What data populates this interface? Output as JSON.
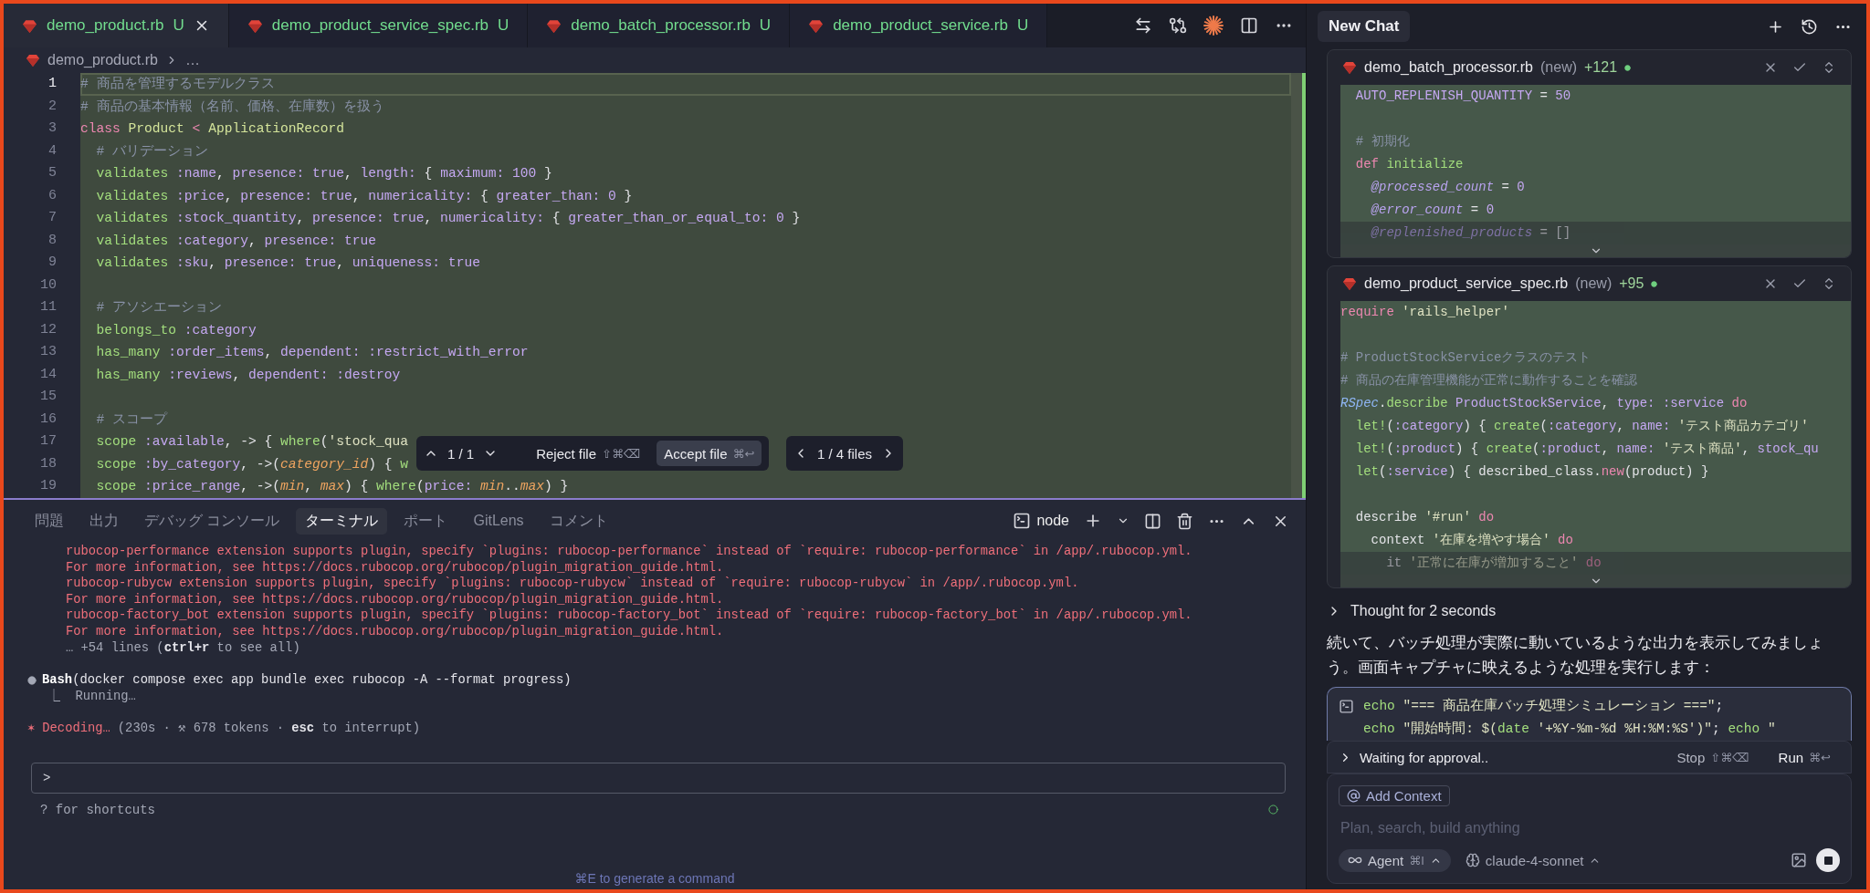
{
  "editor_tabs": [
    {
      "label": "demo_product.rb",
      "status": "U",
      "selected": true
    },
    {
      "label": "demo_product_service_spec.rb",
      "status": "U",
      "selected": false
    },
    {
      "label": "demo_batch_processor.rb",
      "status": "U",
      "selected": false
    },
    {
      "label": "demo_product_service.rb",
      "status": "U",
      "selected": false
    }
  ],
  "breadcrumb": {
    "file": "demo_product.rb",
    "trail": "…"
  },
  "editor": {
    "lines": [
      {
        "number": "1",
        "current": true,
        "added": true,
        "tokens": [
          {
            "kind": "comment",
            "text": "# 商品を管理するモデルクラス"
          }
        ]
      },
      {
        "number": "2",
        "current": false,
        "added": true,
        "tokens": [
          {
            "kind": "comment",
            "text": "# 商品の基本情報（名前、価格、在庫数）を扱う"
          }
        ]
      },
      {
        "number": "3",
        "current": false,
        "added": true,
        "tokens": [
          {
            "kind": "keyword",
            "text": "class"
          },
          {
            "kind": "const",
            "text": " Product"
          },
          {
            "kind": "keyword",
            "text": " <"
          },
          {
            "kind": "const",
            "text": " ApplicationRecord"
          }
        ]
      },
      {
        "number": "4",
        "current": false,
        "added": true,
        "tokens": [
          {
            "kind": "comment",
            "text": "  # バリデーション"
          }
        ]
      },
      {
        "number": "5",
        "current": false,
        "added": true,
        "tokens": [
          {
            "kind": "method",
            "text": "  validates"
          },
          {
            "kind": "symbol",
            "text": " :name"
          },
          {
            "kind": "plain",
            "text": ", "
          },
          {
            "kind": "symbol",
            "text": "presence: true"
          },
          {
            "kind": "plain",
            "text": ", "
          },
          {
            "kind": "symbol",
            "text": "length:"
          },
          {
            "kind": "plain",
            "text": " { "
          },
          {
            "kind": "symbol",
            "text": "maximum: 100"
          },
          {
            "kind": "plain",
            "text": " }"
          }
        ]
      },
      {
        "number": "6",
        "current": false,
        "added": true,
        "tokens": [
          {
            "kind": "method",
            "text": "  validates"
          },
          {
            "kind": "symbol",
            "text": " :price"
          },
          {
            "kind": "plain",
            "text": ", "
          },
          {
            "kind": "symbol",
            "text": "presence: true"
          },
          {
            "kind": "plain",
            "text": ", "
          },
          {
            "kind": "symbol",
            "text": "numericality:"
          },
          {
            "kind": "plain",
            "text": " { "
          },
          {
            "kind": "symbol",
            "text": "greater_than: 0"
          },
          {
            "kind": "plain",
            "text": " }"
          }
        ]
      },
      {
        "number": "7",
        "current": false,
        "added": true,
        "tokens": [
          {
            "kind": "method",
            "text": "  validates"
          },
          {
            "kind": "symbol",
            "text": " :stock_quantity"
          },
          {
            "kind": "plain",
            "text": ", "
          },
          {
            "kind": "symbol",
            "text": "presence: true"
          },
          {
            "kind": "plain",
            "text": ", "
          },
          {
            "kind": "symbol",
            "text": "numericality:"
          },
          {
            "kind": "plain",
            "text": " { "
          },
          {
            "kind": "symbol",
            "text": "greater_than_or_equal_to: 0"
          },
          {
            "kind": "plain",
            "text": " }"
          }
        ]
      },
      {
        "number": "8",
        "current": false,
        "added": true,
        "tokens": [
          {
            "kind": "method",
            "text": "  validates"
          },
          {
            "kind": "symbol",
            "text": " :category"
          },
          {
            "kind": "plain",
            "text": ", "
          },
          {
            "kind": "symbol",
            "text": "presence: true"
          }
        ]
      },
      {
        "number": "9",
        "current": false,
        "added": true,
        "tokens": [
          {
            "kind": "method",
            "text": "  validates"
          },
          {
            "kind": "symbol",
            "text": " :sku"
          },
          {
            "kind": "plain",
            "text": ", "
          },
          {
            "kind": "symbol",
            "text": "presence: true"
          },
          {
            "kind": "plain",
            "text": ", "
          },
          {
            "kind": "symbol",
            "text": "uniqueness: true"
          }
        ]
      },
      {
        "number": "10",
        "current": false,
        "added": true
      },
      {
        "number": "11",
        "current": false,
        "added": true,
        "tokens": [
          {
            "kind": "comment",
            "text": "  # アソシエーション"
          }
        ]
      },
      {
        "number": "12",
        "current": false,
        "added": true,
        "tokens": [
          {
            "kind": "method",
            "text": "  belongs_to"
          },
          {
            "kind": "symbol",
            "text": " :category"
          }
        ]
      },
      {
        "number": "13",
        "current": false,
        "added": true,
        "tokens": [
          {
            "kind": "method",
            "text": "  has_many"
          },
          {
            "kind": "symbol",
            "text": " :order_items"
          },
          {
            "kind": "plain",
            "text": ", "
          },
          {
            "kind": "symbol",
            "text": "dependent: :restrict_with_error"
          }
        ]
      },
      {
        "number": "14",
        "current": false,
        "added": true,
        "tokens": [
          {
            "kind": "method",
            "text": "  has_many"
          },
          {
            "kind": "symbol",
            "text": " :reviews"
          },
          {
            "kind": "plain",
            "text": ", "
          },
          {
            "kind": "symbol",
            "text": "dependent: :destroy"
          }
        ]
      },
      {
        "number": "15",
        "current": false,
        "added": true
      },
      {
        "number": "16",
        "current": false,
        "added": true,
        "tokens": [
          {
            "kind": "comment",
            "text": "  # スコープ"
          }
        ]
      },
      {
        "number": "17",
        "current": false,
        "added": true,
        "tokens": [
          {
            "kind": "method",
            "text": "  scope"
          },
          {
            "kind": "symbol",
            "text": " :available"
          },
          {
            "kind": "plain",
            "text": ", -> { "
          },
          {
            "kind": "method",
            "text": "where"
          },
          {
            "kind": "plain",
            "text": "("
          },
          {
            "kind": "string",
            "text": "'stock_qua"
          }
        ]
      },
      {
        "number": "18",
        "current": false,
        "added": true,
        "tokens": [
          {
            "kind": "method",
            "text": "  scope"
          },
          {
            "kind": "symbol",
            "text": " :by_category"
          },
          {
            "kind": "plain",
            "text": ", ->("
          },
          {
            "kind": "param",
            "text": "category_id"
          },
          {
            "kind": "plain",
            "text": ") { "
          },
          {
            "kind": "method",
            "text": "w"
          }
        ]
      },
      {
        "number": "19",
        "current": false,
        "added": true,
        "tokens": [
          {
            "kind": "method",
            "text": "  scope"
          },
          {
            "kind": "symbol",
            "text": " :price_range"
          },
          {
            "kind": "plain",
            "text": ", ->("
          },
          {
            "kind": "param",
            "text": "min"
          },
          {
            "kind": "plain",
            "text": ", "
          },
          {
            "kind": "param",
            "text": "max"
          },
          {
            "kind": "plain",
            "text": ") { "
          },
          {
            "kind": "method",
            "text": "where"
          },
          {
            "kind": "plain",
            "text": "("
          },
          {
            "kind": "symbol",
            "text": "price:"
          },
          {
            "kind": "param",
            "text": " min"
          },
          {
            "kind": "plain",
            "text": ".."
          },
          {
            "kind": "param",
            "text": "max"
          },
          {
            "kind": "plain",
            "text": ") }"
          }
        ]
      }
    ]
  },
  "diff_toolbar": {
    "hunk_counter": "1 / 1",
    "reject": {
      "label": "Reject file",
      "shortcut": "⇧⌘⌫"
    },
    "accept": {
      "label": "Accept file",
      "shortcut": "⌘↩"
    },
    "file_counter": "1 / 4 files"
  },
  "panel_tabs": [
    {
      "label": "問題",
      "selected": false
    },
    {
      "label": "出力",
      "selected": false
    },
    {
      "label": "デバッグ コンソール",
      "selected": false
    },
    {
      "label": "ターミナル",
      "selected": true
    },
    {
      "label": "ポート",
      "selected": false
    },
    {
      "label": "GitLens",
      "selected": false
    },
    {
      "label": "コメント",
      "selected": false
    }
  ],
  "terminal": {
    "shell": "node",
    "lines": [
      {
        "kind": "error",
        "text": "rubocop-performance extension supports plugin, specify `plugins: rubocop-performance` instead of `require: rubocop-performance` in /app/.rubocop.yml."
      },
      {
        "kind": "error",
        "text": "For more information, see https://docs.rubocop.org/rubocop/plugin_migration_guide.html."
      },
      {
        "kind": "error",
        "text": "rubocop-rubycw extension supports plugin, specify `plugins: rubocop-rubycw` instead of `require: rubocop-rubycw` in /app/.rubocop.yml."
      },
      {
        "kind": "error",
        "text": "For more information, see https://docs.rubocop.org/rubocop/plugin_migration_guide.html."
      },
      {
        "kind": "error",
        "text": "rubocop-factory_bot extension supports plugin, specify `plugins: rubocop-factory_bot` instead of `require: rubocop-factory_bot` in /app/.rubocop.yml."
      },
      {
        "kind": "error",
        "text": "For more information, see https://docs.rubocop.org/rubocop/plugin_migration_guide.html."
      },
      {
        "kind": "note",
        "text": "… +54 lines (**ctrl+r** to see all)"
      },
      {
        "kind": "command",
        "text": "**Bash**(docker compose exec app bundle exec rubocop -A --format progress)"
      },
      {
        "kind": "progress",
        "text": "⎿  Running…"
      },
      {
        "kind": "status",
        "spinner": "✶",
        "label": "Decoding…",
        "detail": "(230s · ⚒ 678 tokens · **esc** to interrupt)"
      }
    ],
    "prompt": ">",
    "hint": "? for shortcuts",
    "generate_hint": "⌘E to generate a command"
  },
  "chat": {
    "tab": "New Chat",
    "files": [
      {
        "name": "demo_batch_processor.rb",
        "status": "(new)",
        "additions": "+121",
        "collapsed": true,
        "lines": [
          {
            "tokens": [
              {
                "kind": "symbol",
                "text": "  AUTO_REPLENISH_QUANTITY"
              },
              {
                "kind": "plain",
                "text": " = "
              },
              {
                "kind": "symbol",
                "text": "50"
              }
            ]
          },
          {
            "blank": true
          },
          {
            "tokens": [
              {
                "kind": "comment",
                "text": "  # 初期化"
              }
            ]
          },
          {
            "tokens": [
              {
                "kind": "keyword",
                "text": "  def"
              },
              {
                "kind": "method",
                "text": " initialize"
              }
            ]
          },
          {
            "tokens": [
              {
                "kind": "ivar",
                "text": "    @processed_count"
              },
              {
                "kind": "plain",
                "text": " = "
              },
              {
                "kind": "symbol",
                "text": "0"
              }
            ]
          },
          {
            "tokens": [
              {
                "kind": "ivar",
                "text": "    @error_count"
              },
              {
                "kind": "plain",
                "text": " = "
              },
              {
                "kind": "symbol",
                "text": "0"
              }
            ]
          },
          {
            "tokens": [
              {
                "kind": "ivar",
                "text": "    @replenished_products"
              },
              {
                "kind": "plain",
                "text": " = []"
              }
            ]
          }
        ]
      },
      {
        "name": "demo_product_service_spec.rb",
        "status": "(new)",
        "additions": "+95",
        "collapsed": true,
        "lines": [
          {
            "tokens": [
              {
                "kind": "keyword",
                "text": "require"
              },
              {
                "kind": "string",
                "text": " 'rails_helper'"
              }
            ]
          },
          {
            "blank": true
          },
          {
            "tokens": [
              {
                "kind": "comment",
                "text": "# ProductStockServiceクラスのテスト"
              }
            ]
          },
          {
            "tokens": [
              {
                "kind": "comment",
                "text": "# 商品の在庫管理機能が正常に動作することを確認"
              }
            ]
          },
          {
            "tokens": [
              {
                "kind": "module",
                "text": "RSpec"
              },
              {
                "kind": "plain",
                "text": "."
              },
              {
                "kind": "method",
                "text": "describe"
              },
              {
                "kind": "symbol",
                "text": " ProductStockService"
              },
              {
                "kind": "plain",
                "text": ", "
              },
              {
                "kind": "symbol",
                "text": "type: :service"
              },
              {
                "kind": "keyword",
                "text": " do"
              }
            ]
          },
          {
            "tokens": [
              {
                "kind": "method",
                "text": "  let!"
              },
              {
                "kind": "plain",
                "text": "("
              },
              {
                "kind": "symbol",
                "text": ":category"
              },
              {
                "kind": "plain",
                "text": ") { "
              },
              {
                "kind": "method",
                "text": "create"
              },
              {
                "kind": "plain",
                "text": "("
              },
              {
                "kind": "symbol",
                "text": ":category"
              },
              {
                "kind": "plain",
                "text": ", "
              },
              {
                "kind": "symbol",
                "text": "name:"
              },
              {
                "kind": "string",
                "text": " 'テスト商品カテゴリ'"
              }
            ]
          },
          {
            "tokens": [
              {
                "kind": "method",
                "text": "  let!"
              },
              {
                "kind": "plain",
                "text": "("
              },
              {
                "kind": "symbol",
                "text": ":product"
              },
              {
                "kind": "plain",
                "text": ") { "
              },
              {
                "kind": "method",
                "text": "create"
              },
              {
                "kind": "plain",
                "text": "("
              },
              {
                "kind": "symbol",
                "text": ":product"
              },
              {
                "kind": "plain",
                "text": ", "
              },
              {
                "kind": "symbol",
                "text": "name:"
              },
              {
                "kind": "string",
                "text": " 'テスト商品'"
              },
              {
                "kind": "plain",
                "text": ", "
              },
              {
                "kind": "symbol",
                "text": "stock_qu"
              }
            ]
          },
          {
            "tokens": [
              {
                "kind": "method",
                "text": "  let"
              },
              {
                "kind": "plain",
                "text": "("
              },
              {
                "kind": "symbol",
                "text": ":service"
              },
              {
                "kind": "plain",
                "text": ") { described_class."
              },
              {
                "kind": "keyword",
                "text": "new"
              },
              {
                "kind": "plain",
                "text": "(product) }"
              }
            ]
          },
          {
            "blank": true
          },
          {
            "tokens": [
              {
                "kind": "plain",
                "text": "  describe"
              },
              {
                "kind": "string",
                "text": " '#run'"
              },
              {
                "kind": "keyword",
                "text": " do"
              }
            ]
          },
          {
            "tokens": [
              {
                "kind": "plain",
                "text": "    context"
              },
              {
                "kind": "string",
                "text": " '在庫を増やす場合'"
              },
              {
                "kind": "keyword",
                "text": " do"
              }
            ]
          },
          {
            "tokens": [
              {
                "kind": "plain",
                "text": "      it"
              },
              {
                "kind": "string",
                "text": " '正常に在庫が増加すること'"
              },
              {
                "kind": "keyword",
                "text": " do"
              }
            ]
          }
        ]
      }
    ],
    "thought": "Thought for 2 seconds",
    "message": "続いて、バッチ処理が実際に動いているような出力を表示してみましょう。画面キャプチャに映えるような処理を実行します：",
    "command": {
      "lines": [
        [
          {
            "kind": "method",
            "text": "echo"
          },
          {
            "kind": "string",
            "text": " \"=== 商品在庫バッチ処理シミュレーション ===\""
          },
          {
            "kind": "plain",
            "text": ";"
          }
        ],
        [
          {
            "kind": "method",
            "text": "echo"
          },
          {
            "kind": "string",
            "text": " \"開始時間: $("
          },
          {
            "kind": "method",
            "text": "date"
          },
          {
            "kind": "string",
            "text": " '+%Y-%m-%d %H:%M:%S')\""
          },
          {
            "kind": "plain",
            "text": "; "
          },
          {
            "kind": "method",
            "text": "echo"
          },
          {
            "kind": "string",
            "text": " \""
          }
        ]
      ]
    },
    "approval": {
      "label": "Waiting for approval..",
      "stop": {
        "label": "Stop",
        "shortcut": "⇧⌘⌫"
      },
      "run": {
        "label": "Run",
        "shortcut": "⌘↩"
      }
    },
    "composer": {
      "context_chip": "Add Context",
      "placeholder": "Plan, search, build anything",
      "mode": {
        "label": "Agent",
        "shortcut": "⌘I"
      },
      "model": "claude-4-sonnet"
    }
  }
}
